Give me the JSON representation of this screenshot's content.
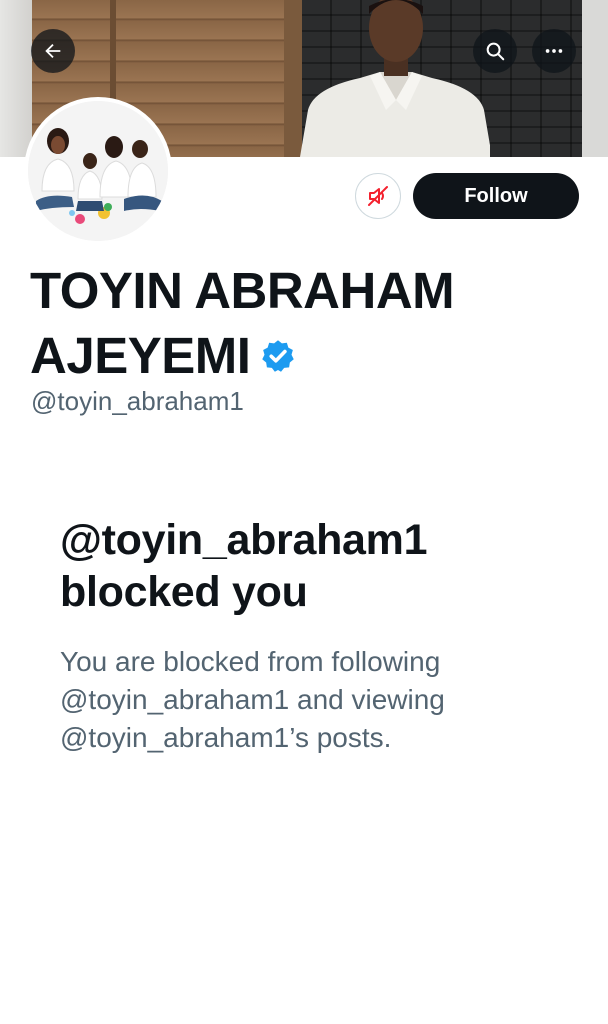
{
  "header": {
    "back_icon": "arrow-left-icon",
    "search_icon": "search-icon",
    "more_icon": "more-horizontal-icon"
  },
  "profile": {
    "display_name_line1": "TOYIN ABRAHAM",
    "display_name_line2": "AJEYEMI",
    "verified_icon": "verified-badge-icon",
    "verified_color": "#1d9bf0",
    "handle": "@toyin_abraham1"
  },
  "actions": {
    "mute_icon": "speaker-muted-icon",
    "mute_color": "#f4212e",
    "follow_label": "Follow"
  },
  "blocked": {
    "title_line1": "@toyin_abraham1",
    "title_line2": "blocked you",
    "desc_line1": "You are blocked from following",
    "desc_line2": "@toyin_abraham1 and viewing",
    "desc_line3": "@toyin_abraham1’s posts."
  }
}
